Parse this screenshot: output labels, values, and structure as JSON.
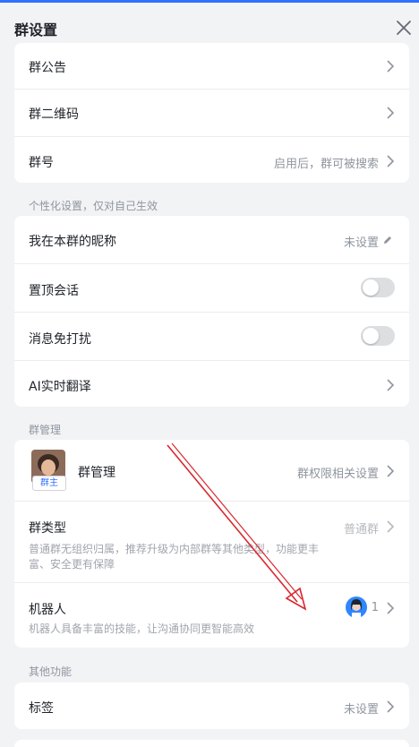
{
  "header": {
    "title": "群设置"
  },
  "card1": {
    "items": [
      {
        "label": "群公告"
      },
      {
        "label": "群二维码"
      },
      {
        "label": "群号",
        "value": "启用后，群可被搜索"
      }
    ]
  },
  "personal": {
    "section_label": "个性化设置，仅对自己生效",
    "nickname": {
      "label": "我在本群的昵称",
      "value": "未设置"
    },
    "pin": {
      "label": "置顶会话",
      "on": false
    },
    "mute": {
      "label": "消息免打扰",
      "on": false
    },
    "translate": {
      "label": "AI实时翻译"
    }
  },
  "management": {
    "section_label": "群管理",
    "admin": {
      "label": "群管理",
      "badge": "群主",
      "value": "群权限相关设置"
    },
    "type": {
      "label": "群类型",
      "value": "普通群",
      "desc_line1": "普通群无组织归属，推荐升级为内部群等其他类型，功能更丰",
      "desc_line2": "富、安全更有保障"
    },
    "bots": {
      "label": "机器人",
      "desc": "机器人具备丰富的技能，让沟通协同更智能高效",
      "count": "1"
    }
  },
  "other": {
    "section_label": "其他功能",
    "tags": {
      "label": "标签",
      "value": "未设置"
    }
  },
  "colors": {
    "accent": "#3370ff",
    "annotation_arrow": "#d9272e"
  }
}
